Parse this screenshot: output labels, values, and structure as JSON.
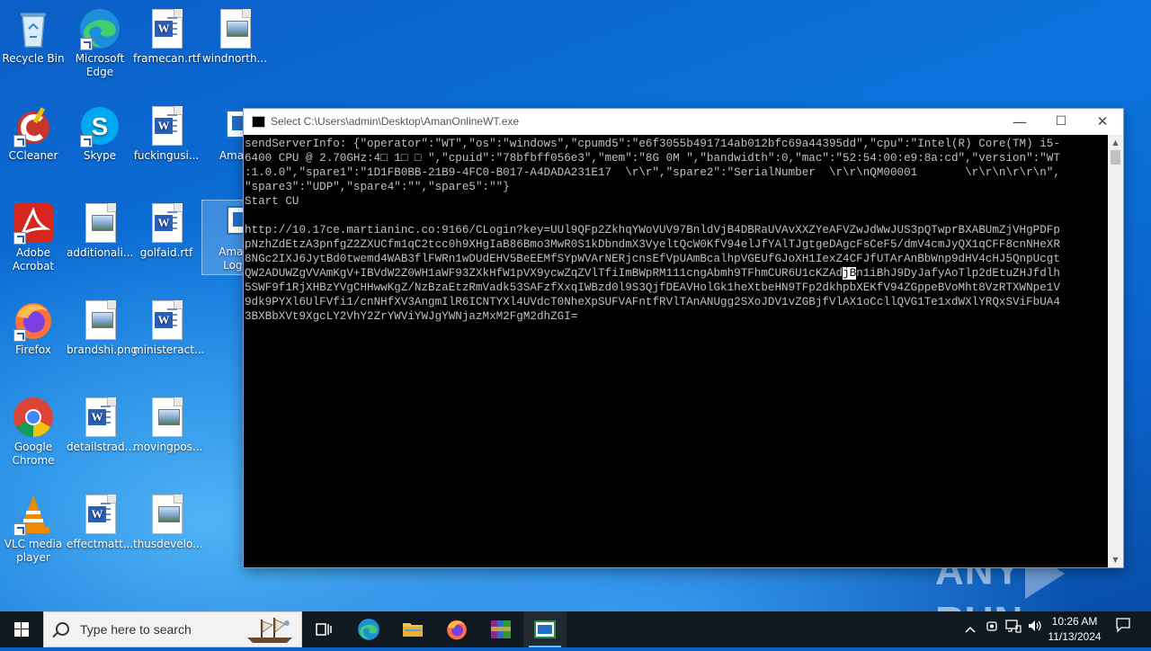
{
  "desktop": {
    "icons": [
      {
        "label": "Recycle Bin",
        "icon": "recycle-bin-icon"
      },
      {
        "label": "Microsoft Edge",
        "icon": "edge-icon"
      },
      {
        "label": "framecan.rtf",
        "icon": "word-document-icon"
      },
      {
        "label": "windnorth...",
        "icon": "image-file-icon"
      },
      {
        "label": "CCleaner",
        "icon": "ccleaner-icon"
      },
      {
        "label": "Skype",
        "icon": "skype-icon"
      },
      {
        "label": "fuckingusi...",
        "icon": "word-document-icon"
      },
      {
        "label": "AmanO",
        "icon": "console-app-icon"
      },
      {
        "label": "Adobe Acrobat",
        "icon": "acrobat-icon"
      },
      {
        "label": "additionali...",
        "icon": "image-file-icon"
      },
      {
        "label": "golfaid.rtf",
        "icon": "word-document-icon"
      },
      {
        "label": "AmanU LogLT",
        "icon": "console-app-icon"
      },
      {
        "label": "Firefox",
        "icon": "firefox-icon"
      },
      {
        "label": "brandshi.png",
        "icon": "image-file-icon"
      },
      {
        "label": "ministeract...",
        "icon": "word-document-icon"
      },
      {
        "label": "Google Chrome",
        "icon": "chrome-icon"
      },
      {
        "label": "detailstrad...",
        "icon": "word-document-icon"
      },
      {
        "label": "movingpos...",
        "icon": "image-file-icon"
      },
      {
        "label": "VLC media player",
        "icon": "vlc-icon"
      },
      {
        "label": "effectmatt...",
        "icon": "word-document-icon"
      },
      {
        "label": "thusdevelo...",
        "icon": "image-file-icon"
      }
    ]
  },
  "window": {
    "title": "Select C:\\Users\\admin\\Desktop\\AmanOnlineWT.exe",
    "minimize": "—",
    "maximize": "☐",
    "close": "✕",
    "console_before_highlight": "sendServerInfo: {\"operator\":\"WT\",\"os\":\"windows\",\"cpumd5\":\"e6f3055b491714ab012bfc69a44395dd\",\"cpu\":\"Intel(R) Core(TM) i5-\n6400 CPU @ 2.70GHz:4□ 1□ □ \",\"cpuid\":\"78bfbff056e3\",\"mem\":\"8G 0M \",\"bandwidth\":0,\"mac\":\"52:54:00:e9:8a:cd\",\"version\":\"WT\n:1.0.0\",\"spare1\":\"1D1FB0BB-21B9-4FC0-B017-A4DADA231E17  \\r\\r\",\"spare2\":\"SerialNumber  \\r\\r\\nQM00001       \\r\\r\\n\\r\\r\\n\",\n\"spare3\":\"UDP\",\"spare4\":\"\",\"spare5\":\"\"}\nStart CU\n\nhttp://10.17ce.martianinc.co:9166/CLogin?key=UUl9QFp2ZkhqYWoVUV97BnldVjB4DBRaUVAvXXZYeAFVZwJdWwJUS3pQTwprBXABUmZjVHgPDFp\npNzhZdEtzA3pnfgZ2ZXUCfm1qC2tcc0h9XHgIaB86Bmo3MwR0S1kDbndmX3VyeltQcW0KfV94elJfYAlTJgtgeDAgcFsCeF5/dmV4cmJyQX1qCFF8cnNHeXR\n8NGc2IXJ6JytBd0twemd4WAB3flFWRn1wDUdEHV5BeEEMfSYpWVArNERjcnsEfVpUAmBcalhpVGEUfGJoXH1IexZ4CFJfUTArAnBbWnp9dHV4cHJ5QnpUcgt\nQW2ADUWZgVVAmKgV+IBVdW2Z0WH1aWF93ZXkHfW1pVX9ycwZqZVlTfiImBWpRM111cngAbmh9TFhmCUR6U1cKZAd",
    "console_highlight": "jB",
    "console_after_highlight": "n1iBhJ9DyJafyAoTlp2dEtuZHJfdlh\n5SWF9f1RjXHBzYVgCHHwwKgZ/NzBzaEtzRmVadk53SAFzfXxqIWBzd0l9S3QjfDEAVHolGk1heXtbeHN9TFp2dkhpbXEKfV94ZGppeBVoMht8VzRTXWNpe1V\n9dk9PYXl6UlFVfi1/cnNHfXV3AngmIlR6ICNTYXl4UVdcT0NheXpSUFVAFntfRVlTAnANUgg2SXoJDV1vZGBjfVlAX1oCcllQVG1Te1xdWXlYRQxSViFbUA4\n3BXBbXVt9XgcLY2VhY2ZrYWViYWJgYWNjazMxM2FgM2dhZGI="
  },
  "taskbar": {
    "search_placeholder": "Type here to search",
    "time": "10:26 AM",
    "date": "11/13/2024"
  },
  "watermark": {
    "left": "ANY",
    "right": "RUN"
  },
  "colors": {
    "desktop": "#0a63c9",
    "taskbar": "#101820",
    "console_bg": "#000000",
    "console_fg": "#c0c0c0"
  }
}
